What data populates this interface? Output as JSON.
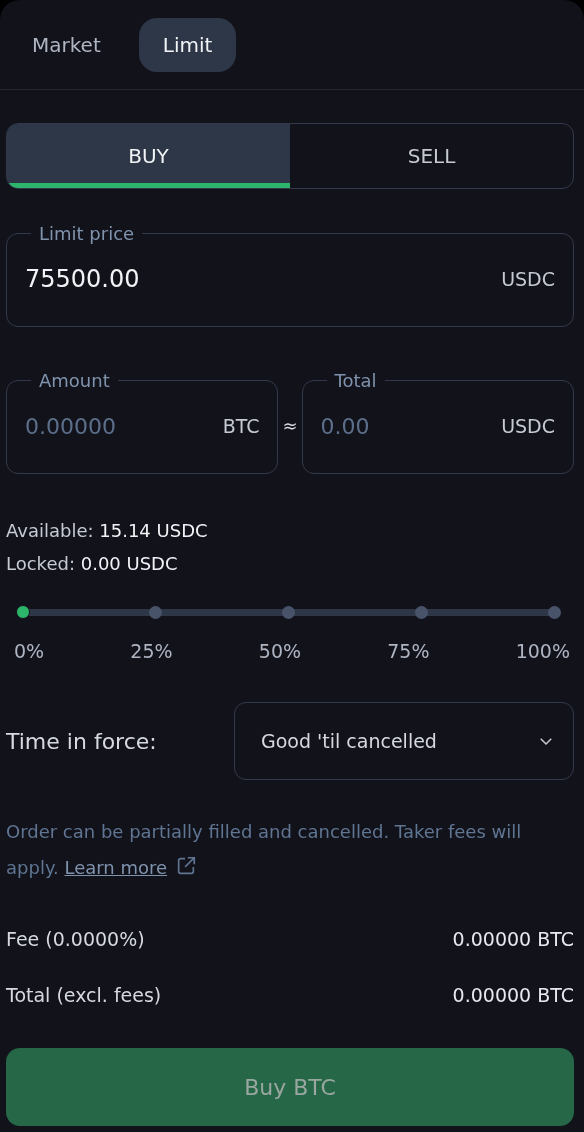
{
  "order_tabs": [
    {
      "label": "Market",
      "selected": false
    },
    {
      "label": "Limit",
      "selected": true
    }
  ],
  "sides": [
    {
      "label": "BUY",
      "selected": true
    },
    {
      "label": "SELL",
      "selected": false
    }
  ],
  "limit_price": {
    "label": "Limit price",
    "value": "75500.00",
    "unit": "USDC"
  },
  "amount": {
    "label": "Amount",
    "placeholder": "0.00000",
    "unit": "BTC"
  },
  "approx": "≈",
  "total": {
    "label": "Total",
    "placeholder": "0.00",
    "unit": "USDC"
  },
  "balances": [
    {
      "label": "Available:",
      "value": "15.14 USDC"
    },
    {
      "label": "Locked:",
      "value": "0.00 USDC"
    }
  ],
  "slider": {
    "level": 0,
    "marks": [
      "0%",
      "25%",
      "50%",
      "75%",
      "100%"
    ]
  },
  "time_in_force": {
    "label": "Time in force:",
    "value": "Good 'til cancelled"
  },
  "info": {
    "text": "Order can be partially filled and cancelled. Taker fees will apply.",
    "link": "Learn more"
  },
  "summary": [
    {
      "label": "Fee (0.0000%)",
      "value": "0.00000 BTC"
    },
    {
      "label": "Total (excl. fees)",
      "value": "0.00000 BTC"
    }
  ],
  "submit": {
    "label": "Buy BTC",
    "disabled": true
  }
}
